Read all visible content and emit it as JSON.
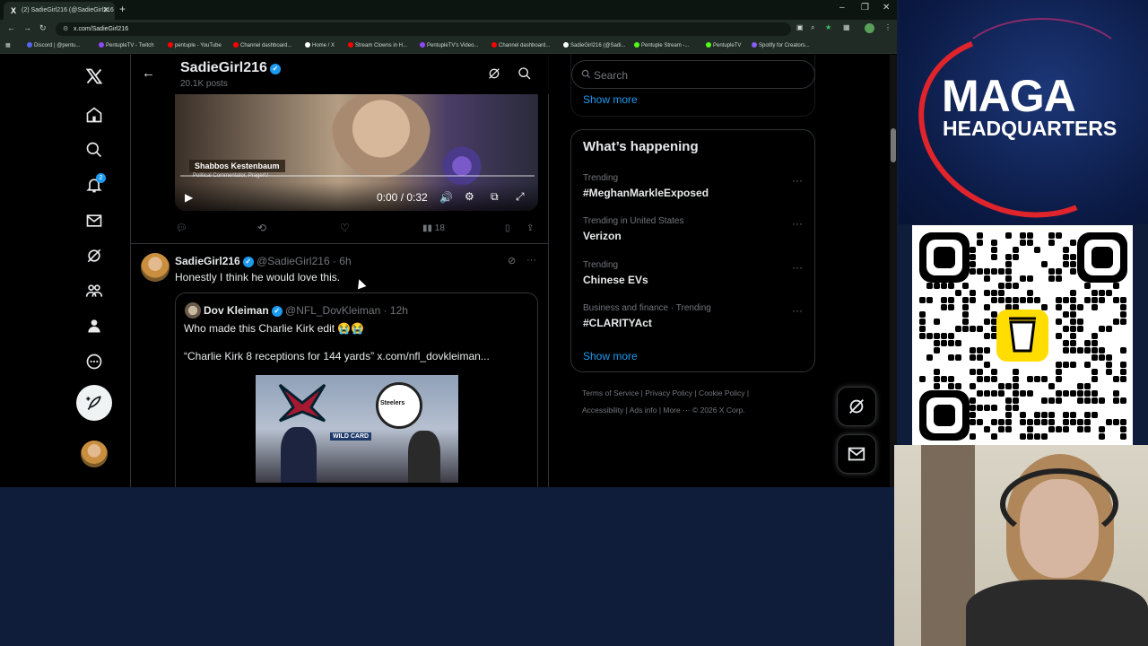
{
  "browser": {
    "tab_title": "(2) SadieGirl216 (@SadieGirl216",
    "url": "x.com/SadieGirl216",
    "bookmarks": [
      {
        "label": "Discord | @pentu...",
        "color": "#5865f2"
      },
      {
        "label": "PentupleTV - Twitch",
        "color": "#9146ff"
      },
      {
        "label": "pentuple - YouTube",
        "color": "#ff0000"
      },
      {
        "label": "Channel dashboard...",
        "color": "#ff0000"
      },
      {
        "label": "Home / X",
        "color": "#ffffff"
      },
      {
        "label": "Stream Clowns in H...",
        "color": "#ff0000"
      },
      {
        "label": "PentupleTV's Video...",
        "color": "#9146ff"
      },
      {
        "label": "Channel dashboard...",
        "color": "#ff0000"
      },
      {
        "label": "SadieGirl216 (@Sadi...",
        "color": "#ffffff"
      },
      {
        "label": "Pentuple Stream -...",
        "color": "#53fc18"
      },
      {
        "label": "PentupleTV",
        "color": "#53fc18"
      },
      {
        "label": "Spotify for Creators...",
        "color": "#8b5cf6"
      }
    ]
  },
  "sidebar": {
    "notification_count": "2"
  },
  "profile_header": {
    "name": "SadieGirl216",
    "posts": "20.1K posts"
  },
  "video_post": {
    "lower_third_name": "Shabbos Kestenbaum",
    "lower_third_title": "Political Commentator, PragerU",
    "time": "0:00 / 0:32",
    "views": "18"
  },
  "tweet": {
    "name": "SadieGirl216",
    "handle": "@SadieGirl216 · 6h",
    "text": "Honestly I think he would love this.",
    "quote": {
      "name": "Dov Kleiman",
      "handle": "@NFL_DovKleiman · 12h",
      "text1": "Who made this Charlie Kirk edit 😭😭",
      "text2": "“Charlie Kirk 8 receptions for 144 yards”  x.com/nfl_dovkleiman...",
      "media_label": "WILD CARD",
      "steelers": "Steelers"
    }
  },
  "right": {
    "search_placeholder": "Search",
    "show_more_top": "Show more",
    "whats_happening": "What’s happening",
    "trends": [
      {
        "context": "Trending",
        "title": "#MeghanMarkleExposed"
      },
      {
        "context": "Trending in United States",
        "title": "Verizon"
      },
      {
        "context": "Trending",
        "title": "Chinese EVs"
      },
      {
        "context": "Business and finance · Trending",
        "title": "#CLARITYAct"
      }
    ],
    "show_more": "Show more",
    "footer1": "Terms of Service  |  Privacy Policy  |  Cookie Policy  |",
    "footer2": "Accessibility  |  Ads info  |  More ···  © 2026 X Corp."
  },
  "overlay": {
    "maga_line1": "MAGA",
    "maga_line2": "HEADQUARTERS"
  }
}
